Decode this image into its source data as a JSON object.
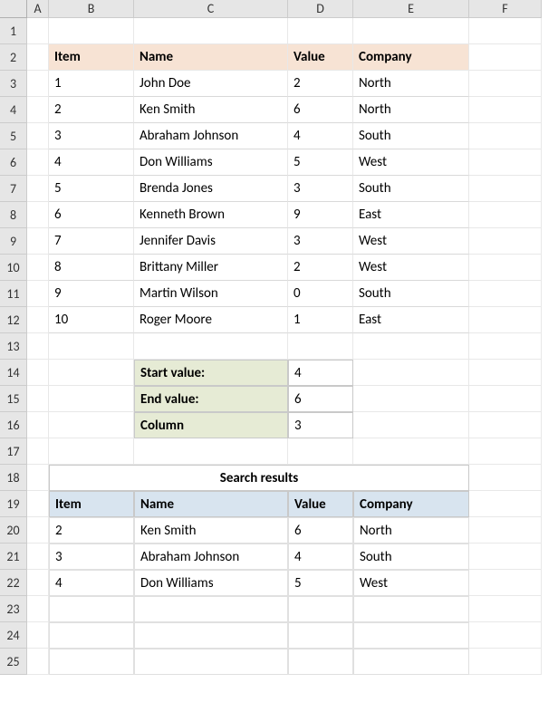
{
  "columns": [
    "A",
    "B",
    "C",
    "D",
    "E",
    "F"
  ],
  "rows": [
    "1",
    "2",
    "3",
    "4",
    "5",
    "6",
    "7",
    "8",
    "9",
    "10",
    "11",
    "12",
    "13",
    "14",
    "15",
    "16",
    "17",
    "18",
    "19",
    "20",
    "21",
    "22",
    "23",
    "24",
    "25"
  ],
  "table1": {
    "headers": [
      "Item",
      "Name",
      "Value",
      "Company"
    ],
    "data": [
      [
        "1",
        "John Doe",
        "2",
        "North"
      ],
      [
        "2",
        "Ken Smith",
        "6",
        "North"
      ],
      [
        "3",
        "Abraham Johnson",
        "4",
        "South"
      ],
      [
        "4",
        "Don Williams",
        "5",
        "West"
      ],
      [
        "5",
        "Brenda Jones",
        "3",
        "South"
      ],
      [
        "6",
        "Kenneth Brown",
        "9",
        "East"
      ],
      [
        "7",
        "Jennifer Davis",
        "3",
        "West"
      ],
      [
        "8",
        "Brittany Miller",
        "2",
        "West"
      ],
      [
        "9",
        "Martin Wilson",
        "0",
        "South"
      ],
      [
        "10",
        "Roger Moore",
        "1",
        "East"
      ]
    ]
  },
  "params": {
    "labels": [
      "Start value:",
      "End value:",
      "Column"
    ],
    "values": [
      "4",
      "6",
      "3"
    ]
  },
  "results": {
    "title": "Search results",
    "headers": [
      "Item",
      "Name",
      "Value",
      "Company"
    ],
    "data": [
      [
        "2",
        "Ken Smith",
        "6",
        "North"
      ],
      [
        "3",
        "Abraham Johnson",
        "4",
        "South"
      ],
      [
        "4",
        "Don Williams",
        "5",
        "West"
      ],
      [
        "",
        "",
        "",
        ""
      ],
      [
        "",
        "",
        "",
        ""
      ],
      [
        "",
        "",
        "",
        ""
      ]
    ]
  }
}
